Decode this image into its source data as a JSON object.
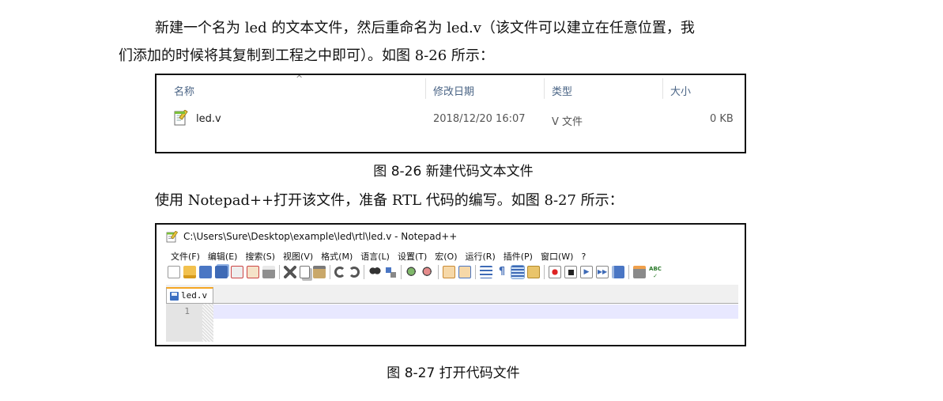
{
  "paragraph1": {
    "line1": "新建一个名为 led 的文本文件，然后重命名为 led.v（该文件可以建立在任意位置，我",
    "line2": "们添加的时候将其复制到工程之中即可）。如图 8-26 所示："
  },
  "figure1": {
    "columns": [
      "名称",
      "修改日期",
      "类型",
      "大小"
    ],
    "sort_indicator": "^",
    "file": {
      "icon": "text-file-icon",
      "name": "led.v",
      "modified": "2018/12/20 16:07",
      "type": "V 文件",
      "size": "0 KB"
    },
    "caption": "图 8-26   新建代码文本文件"
  },
  "paragraph2": "使用 Notepad++打开该文件，准备 RTL 代码的编写。如图 8-27 所示：",
  "figure2": {
    "window_title": "C:\\Users\\Sure\\Desktop\\example\\led\\rtl\\led.v - Notepad++",
    "menu": [
      "文件(F)",
      "编辑(E)",
      "搜索(S)",
      "视图(V)",
      "格式(M)",
      "语言(L)",
      "设置(T)",
      "宏(O)",
      "运行(R)",
      "插件(P)",
      "窗口(W)",
      "?"
    ],
    "toolbar_groups": [
      [
        "new-file-icon",
        "open-file-icon",
        "save-icon",
        "save-all-icon",
        "close-icon",
        "close-all-icon",
        "print-icon"
      ],
      [
        "cut-icon",
        "copy-icon",
        "paste-icon"
      ],
      [
        "undo-icon",
        "redo-icon"
      ],
      [
        "find-icon",
        "replace-icon"
      ],
      [
        "zoom-in-icon",
        "zoom-out-icon"
      ],
      [
        "sync-vertical-icon",
        "sync-horizontal-icon"
      ],
      [
        "word-wrap-icon",
        "show-all-chars-icon",
        "indent-guide-icon",
        "doc-map-icon"
      ],
      [
        "record-macro-icon",
        "stop-macro-icon",
        "play-macro-icon",
        "run-macro-multiple-icon",
        "save-macro-icon"
      ],
      [
        "document-list-icon",
        "spell-check-icon"
      ]
    ],
    "tab_label": "led.v",
    "line_number": "1",
    "caption": "图 8-27   打开代码文件"
  }
}
